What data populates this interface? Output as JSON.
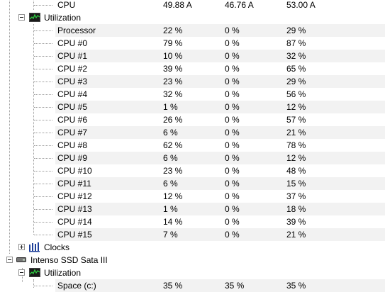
{
  "top_row": {
    "label": "CPU",
    "v1": "49.88 A",
    "v2": "46.76 A",
    "v3": "53.00 A"
  },
  "cpu_utilization": {
    "label": "Utilization",
    "rows": [
      {
        "name": "Processor",
        "v1": "22 %",
        "v2": "0 %",
        "v3": "29 %"
      },
      {
        "name": "CPU #0",
        "v1": "79 %",
        "v2": "0 %",
        "v3": "87 %"
      },
      {
        "name": "CPU #1",
        "v1": "10 %",
        "v2": "0 %",
        "v3": "32 %"
      },
      {
        "name": "CPU #2",
        "v1": "39 %",
        "v2": "0 %",
        "v3": "65 %"
      },
      {
        "name": "CPU #3",
        "v1": "23 %",
        "v2": "0 %",
        "v3": "29 %"
      },
      {
        "name": "CPU #4",
        "v1": "32 %",
        "v2": "0 %",
        "v3": "56 %"
      },
      {
        "name": "CPU #5",
        "v1": "1 %",
        "v2": "0 %",
        "v3": "12 %"
      },
      {
        "name": "CPU #6",
        "v1": "26 %",
        "v2": "0 %",
        "v3": "57 %"
      },
      {
        "name": "CPU #7",
        "v1": "6 %",
        "v2": "0 %",
        "v3": "21 %"
      },
      {
        "name": "CPU #8",
        "v1": "62 %",
        "v2": "0 %",
        "v3": "78 %"
      },
      {
        "name": "CPU #9",
        "v1": "6 %",
        "v2": "0 %",
        "v3": "12 %"
      },
      {
        "name": "CPU #10",
        "v1": "23 %",
        "v2": "0 %",
        "v3": "48 %"
      },
      {
        "name": "CPU #11",
        "v1": "6 %",
        "v2": "0 %",
        "v3": "15 %"
      },
      {
        "name": "CPU #12",
        "v1": "12 %",
        "v2": "0 %",
        "v3": "37 %"
      },
      {
        "name": "CPU #13",
        "v1": "1 %",
        "v2": "0 %",
        "v3": "18 %"
      },
      {
        "name": "CPU #14",
        "v1": "14 %",
        "v2": "0 %",
        "v3": "39 %"
      },
      {
        "name": "CPU #15",
        "v1": "7 %",
        "v2": "0 %",
        "v3": "21 %"
      }
    ]
  },
  "clocks": {
    "label": "Clocks"
  },
  "ssd": {
    "label": "Intenso SSD Sata III",
    "utilization_label": "Utilization",
    "space_row": {
      "name": "Space (c:)",
      "v1": "35 %",
      "v2": "35 %",
      "v3": "35 %"
    }
  },
  "icons": {
    "utilization": "utilization-graph-icon",
    "clocks": "clocks-bars-icon",
    "ssd": "hard-drive-icon"
  }
}
